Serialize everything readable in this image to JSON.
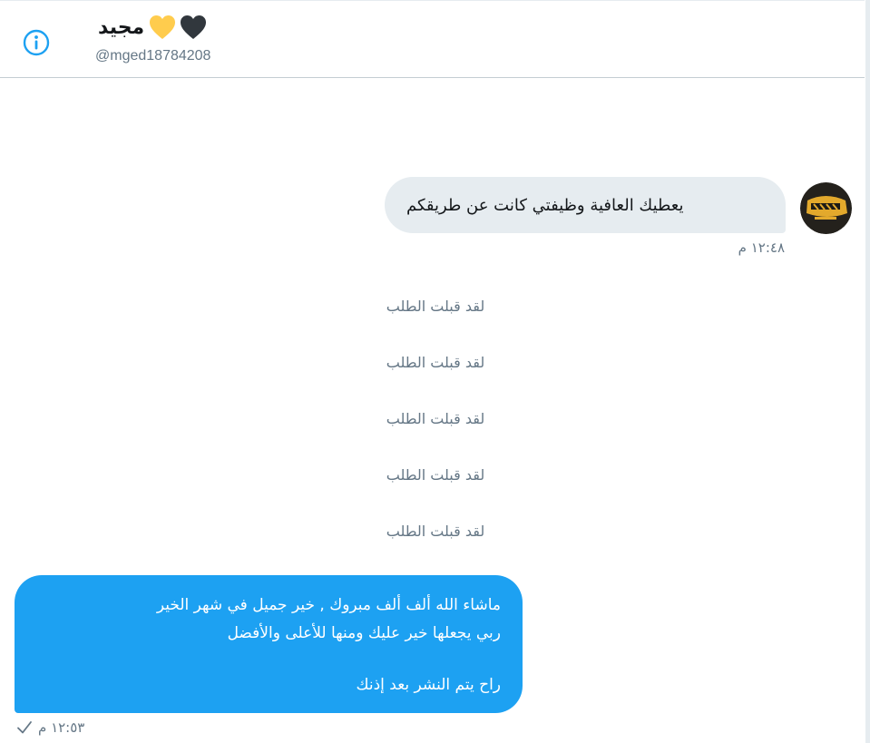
{
  "header": {
    "display_name": "مجيد",
    "handle": "@mged18784208",
    "icons": [
      "info-icon",
      "yellow-heart-icon",
      "black-heart-icon"
    ]
  },
  "messages": {
    "incoming": {
      "text": "يعطيك العافية وظيفتي كانت عن طريقكم",
      "time": "١٢:٤٨ م"
    },
    "system_notices": [
      "لقد قبلت الطلب",
      "لقد قبلت الطلب",
      "لقد قبلت الطلب",
      "لقد قبلت الطلب",
      "لقد قبلت الطلب"
    ],
    "outgoing": {
      "lines": [
        "ماشاء الله ألف ألف مبروك , خير جميل في شهر الخير",
        "ربي يجعلها خير عليك ومنها للأعلى والأفضل",
        "راح يتم النشر بعد إذنك"
      ],
      "time": "١٢:٥٣ م",
      "status_icon": "check-icon"
    }
  },
  "colors": {
    "accent": "#1da1f2",
    "incoming_bubble": "#e6ecf0",
    "secondary_text": "#657786",
    "heart_yellow": "#ffcc4d",
    "heart_black": "#31373d"
  }
}
